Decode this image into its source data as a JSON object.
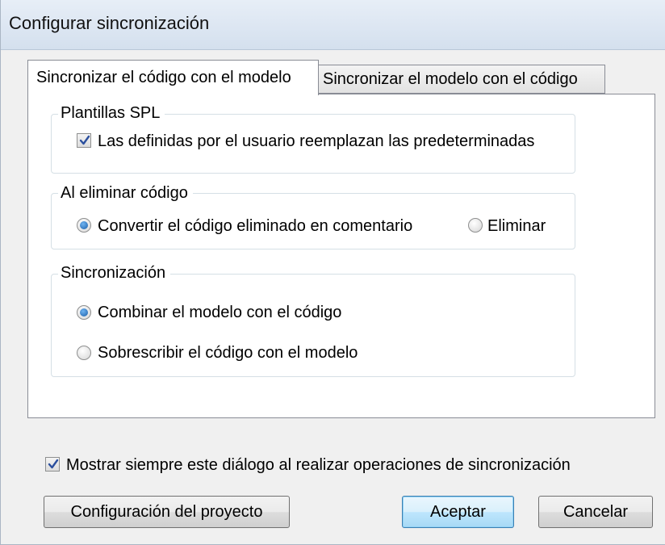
{
  "window": {
    "title": "Configurar sincronización"
  },
  "tabs": [
    {
      "label": "Sincronizar el código con el modelo",
      "active": true
    },
    {
      "label": "Sincronizar el modelo con el código",
      "active": false
    }
  ],
  "groups": {
    "spl": {
      "label": "Plantillas SPL",
      "checkbox_label": "Las definidas por el usuario reemplazan las predeterminadas",
      "checked": true
    },
    "delete": {
      "label": "Al eliminar código",
      "options": [
        {
          "label": "Convertir el código eliminado en comentario",
          "selected": true
        },
        {
          "label": "Eliminar",
          "selected": false
        }
      ]
    },
    "sync": {
      "label": "Sincronización",
      "options": [
        {
          "label": "Combinar el modelo con el código",
          "selected": true
        },
        {
          "label": "Sobrescribir el código con el modelo",
          "selected": false
        }
      ]
    }
  },
  "footer": {
    "always_show_label": "Mostrar siempre este diálogo al realizar operaciones de sincronización",
    "always_show_checked": true
  },
  "buttons": {
    "project_settings": "Configuración del proyecto",
    "accept": "Aceptar",
    "cancel": "Cancelar"
  },
  "colors": {
    "dialog_bg": "#f0f0f0",
    "titlebar": "#d4e0ee",
    "check_mark": "#2b4f9e",
    "radio_dot": "#1b5ea8",
    "default_button_border": "#3c7fb1"
  }
}
